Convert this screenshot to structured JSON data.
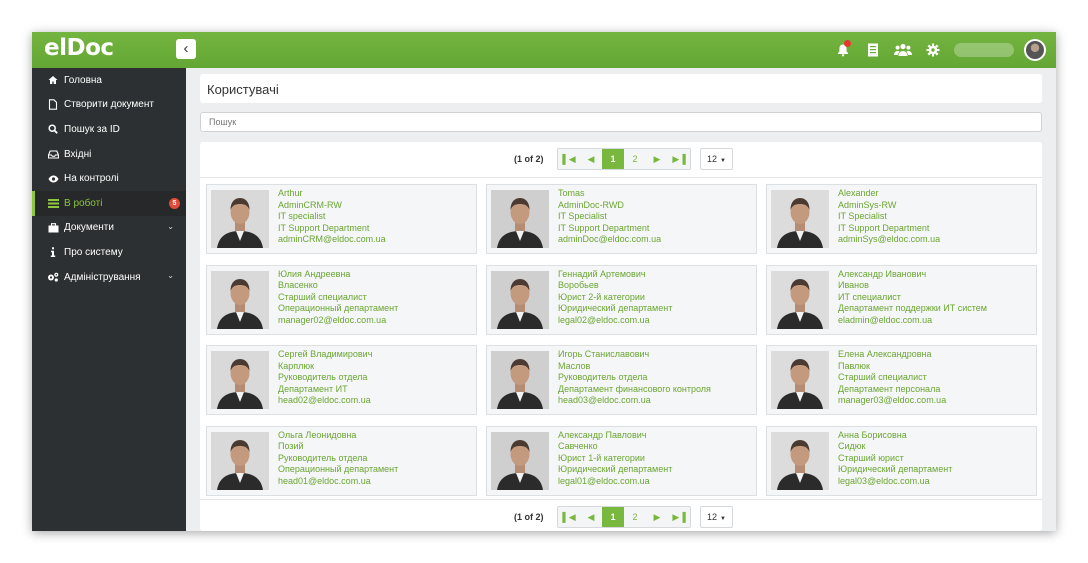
{
  "app": {
    "logo": "elDoc",
    "collapse_icon": "chevron-left-icon"
  },
  "header": {
    "icons": [
      "bell-icon",
      "document-icon",
      "users-icon",
      "gear-icon",
      "user-avatar"
    ],
    "notification_dot_color": "#e8372d"
  },
  "sidebar": {
    "items": [
      {
        "label": "Головна",
        "icon": "home-icon"
      },
      {
        "label": "Створити документ",
        "icon": "file-icon"
      },
      {
        "label": "Пошук за ID",
        "icon": "search-icon"
      },
      {
        "label": "Вхідні",
        "icon": "inbox-icon"
      },
      {
        "label": "На контролі",
        "icon": "eye-icon"
      },
      {
        "label": "В роботі",
        "icon": "tasks-icon",
        "badge": "5",
        "active": true
      },
      {
        "label": "Документи",
        "icon": "briefcase-icon",
        "expandable": true
      },
      {
        "label": "Про систему",
        "icon": "info-icon"
      },
      {
        "label": "Адміністрування",
        "icon": "cogs-icon",
        "expandable": true
      }
    ]
  },
  "page": {
    "title": "Користувачі",
    "search_placeholder": "Пошук"
  },
  "pager": {
    "count": "(1 of 2)",
    "pages": [
      "1",
      "2"
    ],
    "current": "1",
    "page_size": "12"
  },
  "colors": {
    "brand_green": "#6aac36",
    "sidebar": "#2d3032",
    "link_green": "#6aa632",
    "badge": "#e04b3a"
  },
  "users": [
    {
      "first": "Arthur",
      "last": "AdminCRM-RW",
      "position": "IT specialist",
      "department": "IT Support Department",
      "email": "adminCRM@eldoc.com.ua"
    },
    {
      "first": "Tomas",
      "last": "AdminDoc-RWD",
      "position": "IT Specialist",
      "department": "IT Support Department",
      "email": "adminDoc@eldoc.com.ua"
    },
    {
      "first": "Alexander",
      "last": "AdminSys-RW",
      "position": "IT Specialist",
      "department": "IT Support Department",
      "email": "adminSys@eldoc.com.ua"
    },
    {
      "first": "Юлия Андреевна",
      "last": "Власенко",
      "position": "Старший специалист",
      "department": "Операционный департамент",
      "email": "manager02@eldoc.com.ua"
    },
    {
      "first": "Геннадий Артемович",
      "last": "Воробьев",
      "position": "Юрист 2-й категории",
      "department": "Юридический департамент",
      "email": "legal02@eldoc.com.ua"
    },
    {
      "first": "Александр Иванович",
      "last": "Иванов",
      "position": "ИТ специалист",
      "department": "Департамент поддержки ИТ систем",
      "email": "eladmin@eldoc.com.ua"
    },
    {
      "first": "Сергей Владимирович",
      "last": "Карплюк",
      "position": "Руководитель отдела",
      "department": "Департамент ИТ",
      "email": "head02@eldoc.com.ua"
    },
    {
      "first": "Игорь Станиславович",
      "last": "Маслов",
      "position": "Руководитель отдела",
      "department": "Департамент финансового контроля",
      "email": "head03@eldoc.com.ua"
    },
    {
      "first": "Елена Александровна",
      "last": "Павлюк",
      "position": "Старший специалист",
      "department": "Департамент персонала",
      "email": "manager03@eldoc.com.ua"
    },
    {
      "first": "Ольга Леонидовна",
      "last": "Позий",
      "position": "Руководитель отдела",
      "department": "Операционный департамент",
      "email": "head01@eldoc.com.ua"
    },
    {
      "first": "Александр Павлович",
      "last": "Савченко",
      "position": "Юрист 1-й категории",
      "department": "Юридический департамент",
      "email": "legal01@eldoc.com.ua"
    },
    {
      "first": "Анна Борисовна",
      "last": "Сидюк",
      "position": "Старший юрист",
      "department": "Юридический департамент",
      "email": "legal03@eldoc.com.ua"
    }
  ]
}
